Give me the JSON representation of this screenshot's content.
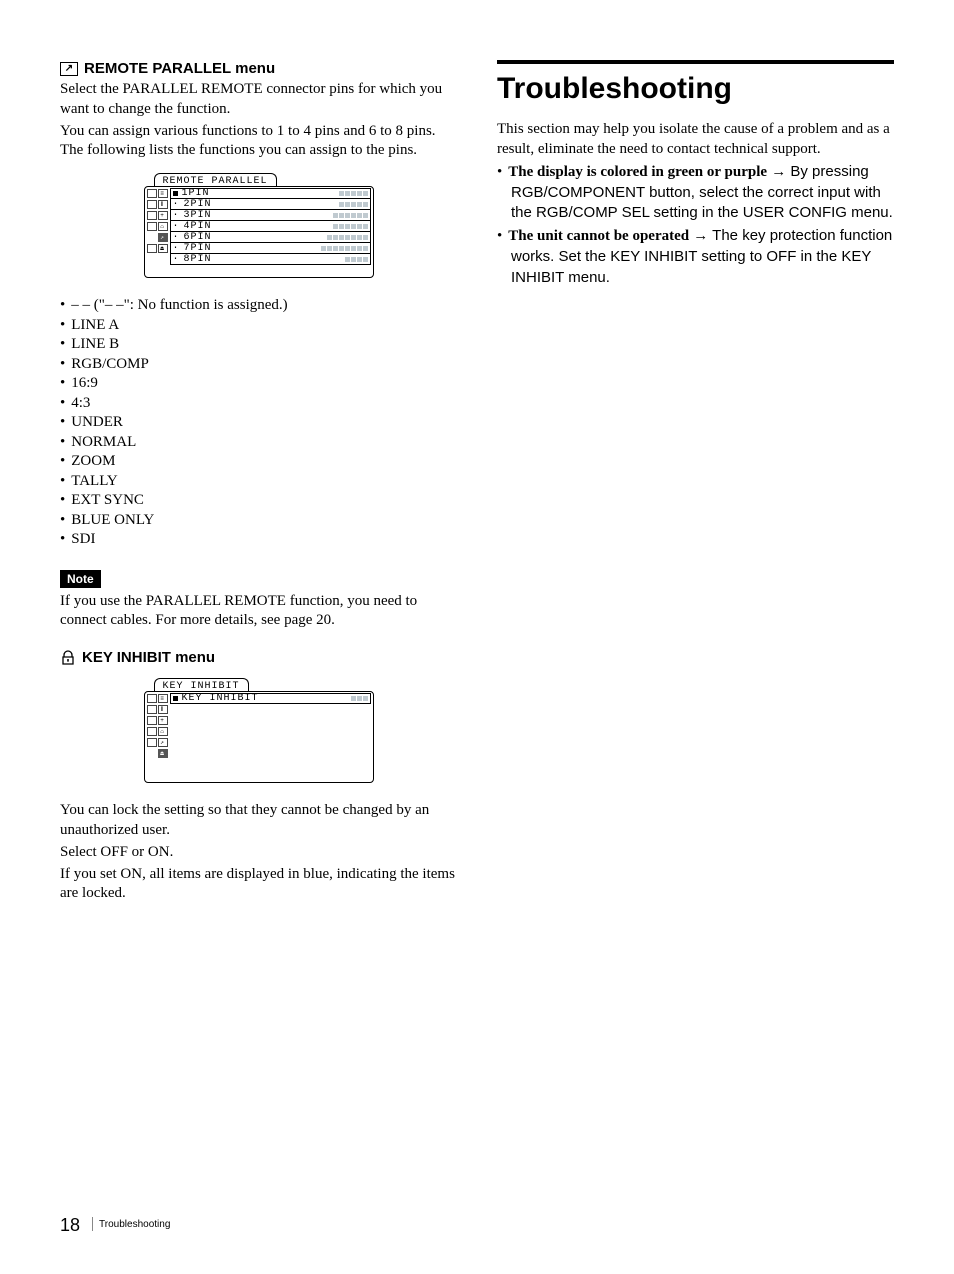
{
  "left": {
    "heading1": "REMOTE PARALLEL menu",
    "intro1": "Select the PARALLEL REMOTE connector pins for which you want to change the function.",
    "intro2": "You can assign various functions to 1 to 4 pins and 6 to 8 pins. The following lists the functions you can assign to the pins.",
    "menu1": {
      "title": "REMOTE PARALLEL",
      "rows": [
        {
          "label": "1PIN",
          "bars": 5,
          "sel": true
        },
        {
          "label": "2PIN",
          "bars": 5
        },
        {
          "label": "3PIN",
          "bars": 6
        },
        {
          "label": "4PIN",
          "bars": 6
        },
        {
          "label": "6PIN",
          "bars": 7
        },
        {
          "label": "7PIN",
          "bars": 8
        },
        {
          "label": "8PIN",
          "bars": 4
        }
      ]
    },
    "options": [
      "– –  (\"– –\": No function is assigned.)",
      "LINE A",
      "LINE B",
      "RGB/COMP",
      "16:9",
      "4:3",
      "UNDER",
      "NORMAL",
      "ZOOM",
      "TALLY",
      "EXT SYNC",
      "BLUE ONLY",
      "SDI"
    ],
    "note_label": "Note",
    "note_text": "If you use the PARALLEL REMOTE function, you need to connect cables. For more details, see page 20.",
    "heading2": "KEY INHIBIT menu",
    "menu2": {
      "title": "KEY INHIBIT",
      "row_label": "KEY  INHIBIT",
      "bars": 3
    },
    "desc1": "You can lock the setting so that they cannot be changed by an unauthorized user.",
    "desc2": "Select OFF or ON.",
    "desc3": "If you set ON, all items are displayed in blue, indicating the items are locked."
  },
  "right": {
    "heading": "Troubleshooting",
    "intro": "This section may help you isolate the cause of a problem and as a result, eliminate the need to contact technical support.",
    "items": [
      {
        "bold": "The display is colored in green or purple",
        "rest": " → By pressing RGB/COMPONENT button, select the correct input with the RGB/COMP SEL setting in the USER CONFIG menu."
      },
      {
        "bold": "The unit cannot be operated",
        "rest": " → The key protection function works.  Set the KEY INHIBIT setting to OFF in the KEY INHIBIT menu."
      }
    ]
  },
  "footer": {
    "page": "18",
    "section": "Troubleshooting"
  }
}
